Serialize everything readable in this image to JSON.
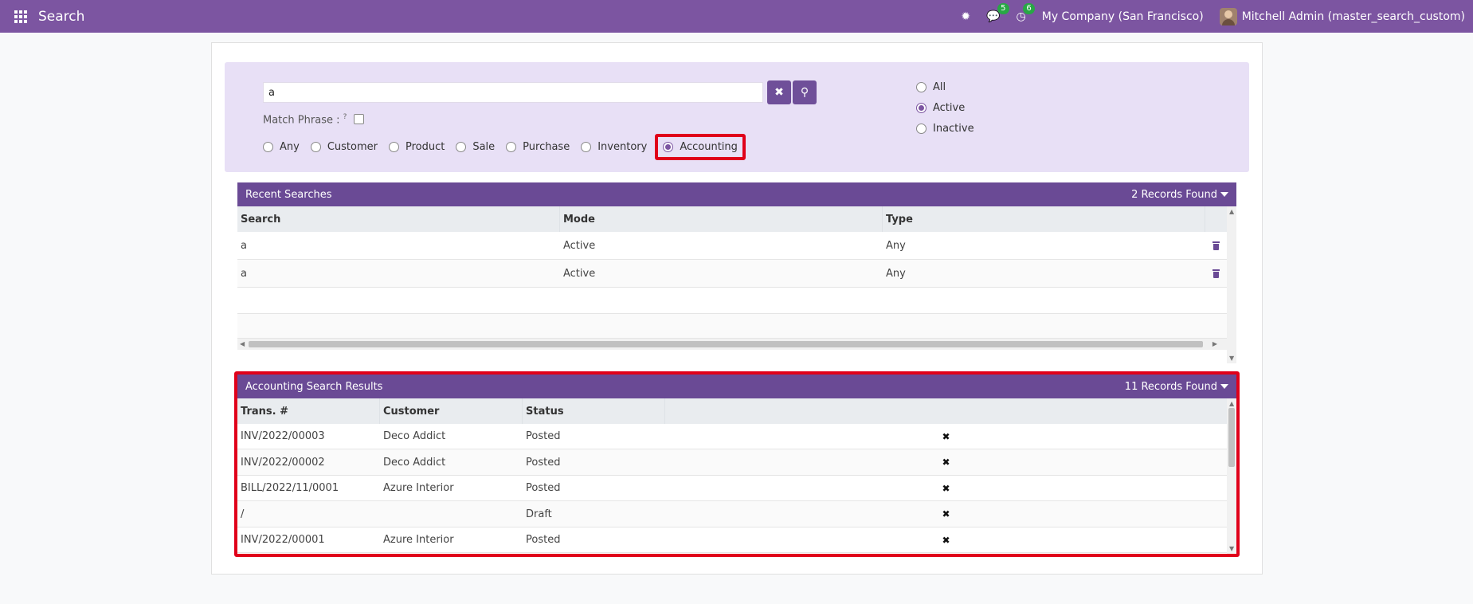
{
  "navbar": {
    "title": "Search",
    "chat_badge": "5",
    "activity_badge": "6",
    "company": "My Company (San Francisco)",
    "user": "Mitchell Admin (master_search_custom)"
  },
  "search": {
    "value": "a",
    "match_phrase_label": "Match Phrase :",
    "match_phrase_hint": "?",
    "modes": [
      {
        "label": "Any",
        "checked": false
      },
      {
        "label": "Customer",
        "checked": false
      },
      {
        "label": "Product",
        "checked": false
      },
      {
        "label": "Sale",
        "checked": false
      },
      {
        "label": "Purchase",
        "checked": false
      },
      {
        "label": "Inventory",
        "checked": false
      },
      {
        "label": "Accounting",
        "checked": true
      }
    ],
    "status_options": [
      {
        "label": "All",
        "checked": false
      },
      {
        "label": "Active",
        "checked": true
      },
      {
        "label": "Inactive",
        "checked": false
      }
    ]
  },
  "recent": {
    "title": "Recent Searches",
    "count": "2 Records Found",
    "columns": [
      "Search",
      "Mode",
      "Type"
    ],
    "rows": [
      [
        "a",
        "Active",
        "Any"
      ],
      [
        "a",
        "Active",
        "Any"
      ]
    ]
  },
  "results": {
    "title": "Accounting Search Results",
    "count": "11 Records Found",
    "columns": [
      "Trans. #",
      "Customer",
      "Status"
    ],
    "rows": [
      [
        "INV/2022/00003",
        "Deco Addict",
        "Posted"
      ],
      [
        "INV/2022/00002",
        "Deco Addict",
        "Posted"
      ],
      [
        "BILL/2022/11/0001",
        "Azure Interior",
        "Posted"
      ],
      [
        "/",
        "",
        "Draft"
      ],
      [
        "INV/2022/00001",
        "Azure Interior",
        "Posted"
      ]
    ]
  },
  "colors": {
    "navbar": "#7c55a1",
    "section_header": "#6a4a95",
    "panel_bg": "#e8e0f6",
    "highlight": "#e0001a"
  }
}
